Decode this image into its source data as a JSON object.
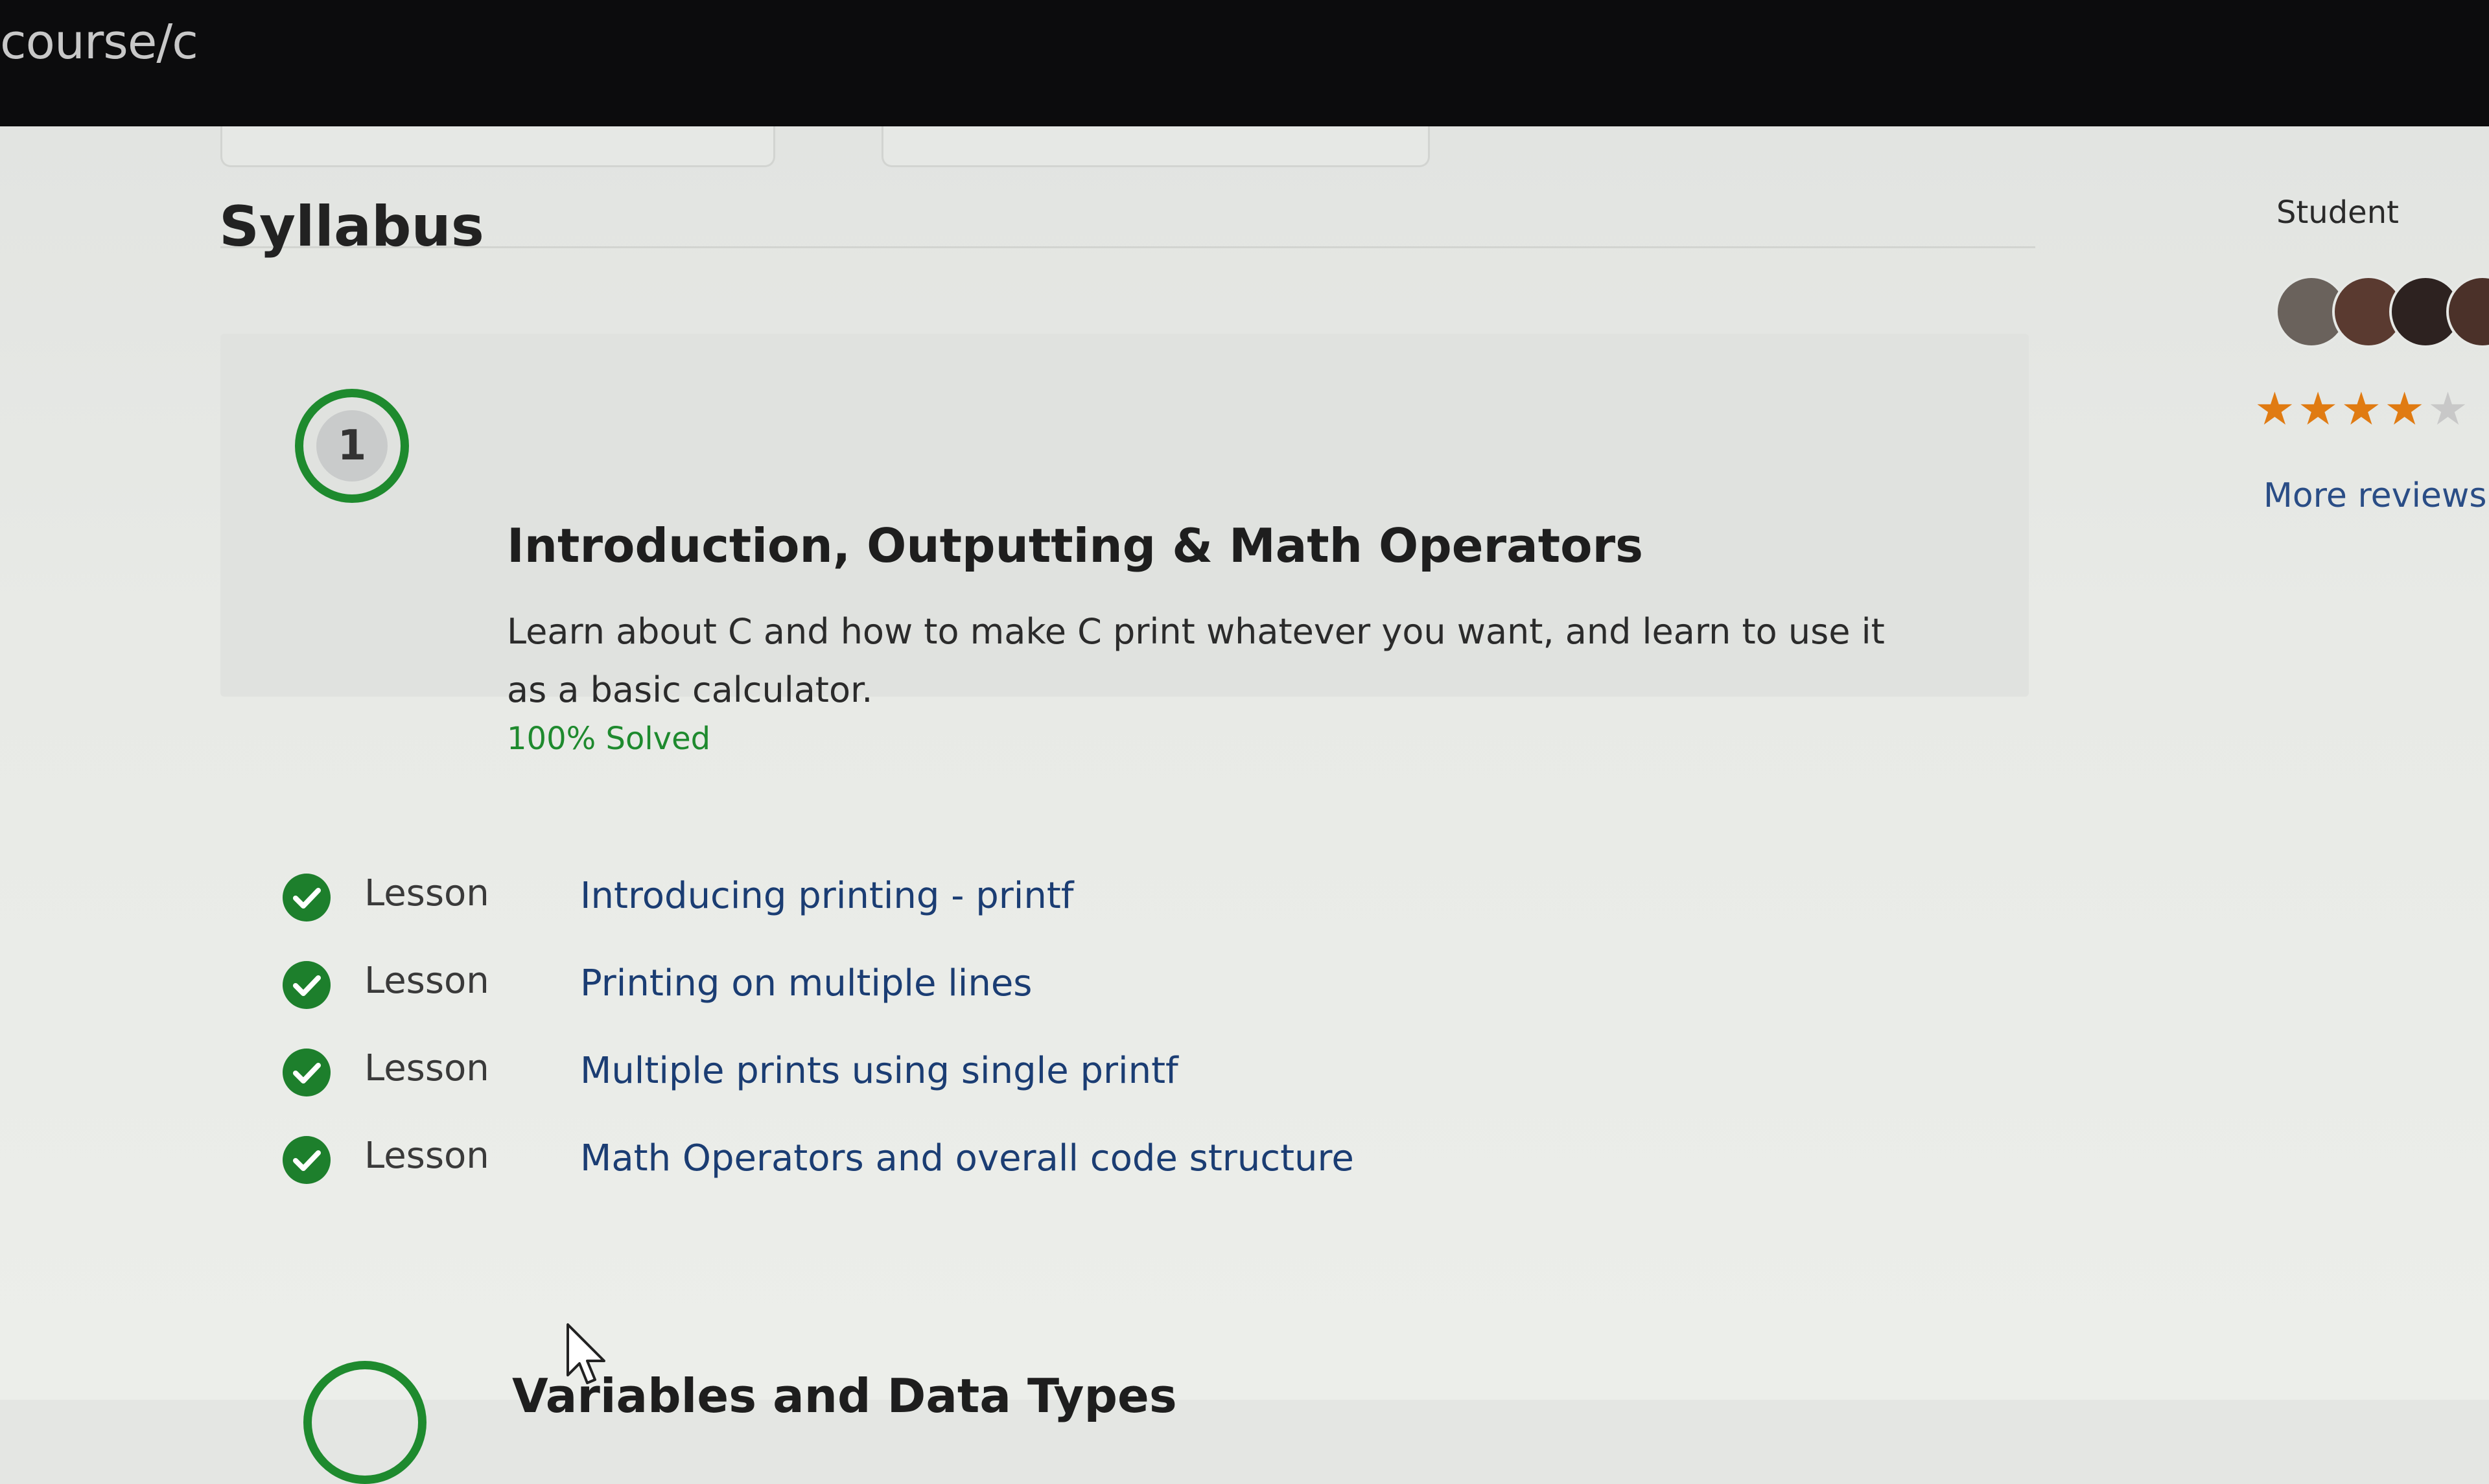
{
  "browser": {
    "url_text": "course/c"
  },
  "syllabus": {
    "title": "Syllabus"
  },
  "module": {
    "number": "1",
    "title": "Introduction, Outputting & Math Operators",
    "description": "Learn about C and how to make C print whatever you want, and learn to use it as a basic calculator.",
    "progress": "100% Solved",
    "accent_color": "#1e8a2e",
    "lessons": [
      {
        "type": "Lesson",
        "title": "Introducing printing - printf",
        "status_icon": "check-circle-icon"
      },
      {
        "type": "Lesson",
        "title": "Printing on multiple lines",
        "status_icon": "check-circle-icon"
      },
      {
        "type": "Lesson",
        "title": "Multiple prints using single printf",
        "status_icon": "check-circle-icon"
      },
      {
        "type": "Lesson",
        "title": "Math Operators and overall code structure",
        "status_icon": "check-circle-icon"
      }
    ]
  },
  "next_module": {
    "title": "Variables and Data Types"
  },
  "sidebar": {
    "student_label": "Student",
    "rating_stars": 4,
    "rating_max": 5,
    "star_color": "#e07b12",
    "more_reviews": "More reviews"
  }
}
